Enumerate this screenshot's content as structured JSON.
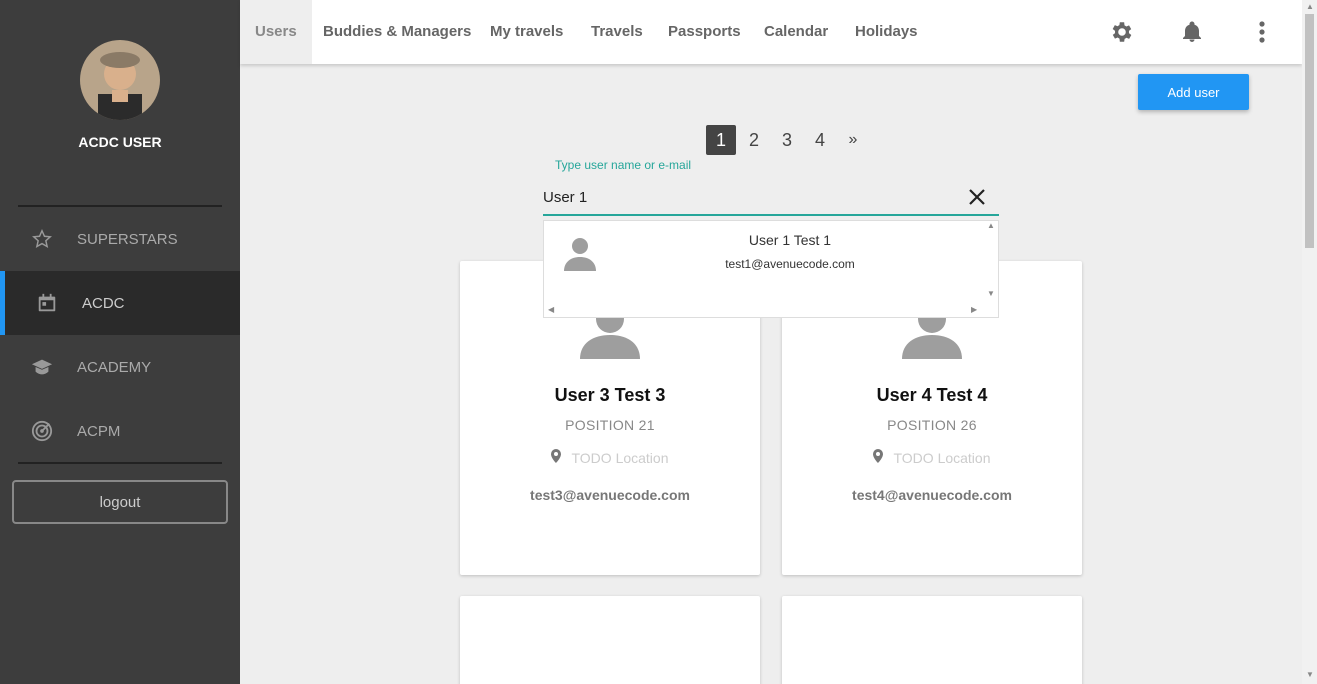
{
  "user": {
    "name": "ACDC USER"
  },
  "sidebar": {
    "items": [
      {
        "label": "SUPERSTARS",
        "icon": "star-icon"
      },
      {
        "label": "ACDC",
        "icon": "calendar-icon",
        "active": true
      },
      {
        "label": "ACADEMY",
        "icon": "graduation-cap-icon"
      },
      {
        "label": "ACPM",
        "icon": "radar-icon"
      }
    ],
    "logout_label": "logout"
  },
  "tabs": [
    {
      "label": "Users",
      "active": true
    },
    {
      "label": "Buddies & Managers"
    },
    {
      "label": "My travels"
    },
    {
      "label": "Travels"
    },
    {
      "label": "Passports"
    },
    {
      "label": "Calendar"
    },
    {
      "label": "Holidays"
    }
  ],
  "toolbar": {
    "add_user_label": "Add user"
  },
  "pagination": {
    "pages": [
      "1",
      "2",
      "3",
      "4"
    ],
    "next": "»",
    "current": "1"
  },
  "search": {
    "label": "Type user name or e-mail",
    "value": "User 1"
  },
  "suggestions": [
    {
      "name": "User 1 Test 1",
      "email": "test1@avenuecode.com"
    }
  ],
  "cards": [
    {
      "name": "User 3 Test 3",
      "position": "POSITION 21",
      "location": "TODO Location",
      "email": "test3@avenuecode.com"
    },
    {
      "name": "User 4 Test 4",
      "position": "POSITION 26",
      "location": "TODO Location",
      "email": "test4@avenuecode.com"
    }
  ],
  "colors": {
    "accent": "#2196f3",
    "teal": "#26a69a",
    "sidebar": "#3d3d3d"
  }
}
